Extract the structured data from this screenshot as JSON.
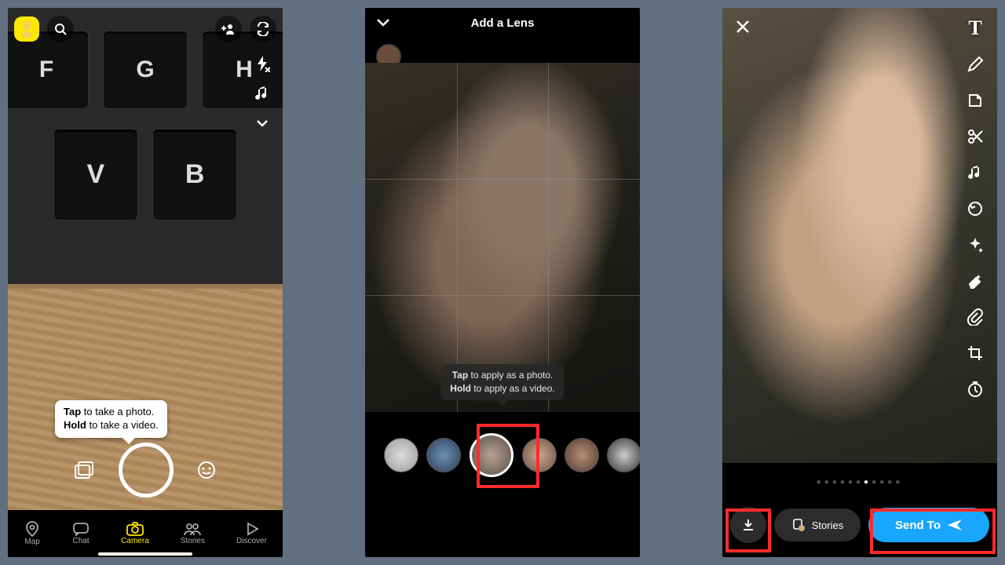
{
  "screen1": {
    "keys_row1": [
      "F",
      "G",
      "H"
    ],
    "keys_row2": [
      "V",
      "B"
    ],
    "tooltip_l1_b": "Tap",
    "tooltip_l1_r": " to take a photo.",
    "tooltip_l2_b": "Hold",
    "tooltip_l2_r": " to take a video.",
    "nav": {
      "map": "Map",
      "chat": "Chat",
      "camera": "Camera",
      "stories": "Stories",
      "discover": "Discover"
    }
  },
  "screen2": {
    "title": "Add a Lens",
    "tooltip_l1_b": "Tap",
    "tooltip_l1_r": " to apply as a photo.",
    "tooltip_l2_b": "Hold",
    "tooltip_l2_r": " to apply as a video."
  },
  "screen3": {
    "dots_total": 11,
    "dots_active_index": 6,
    "stories_label": "Stories",
    "send_label": "Send To"
  }
}
